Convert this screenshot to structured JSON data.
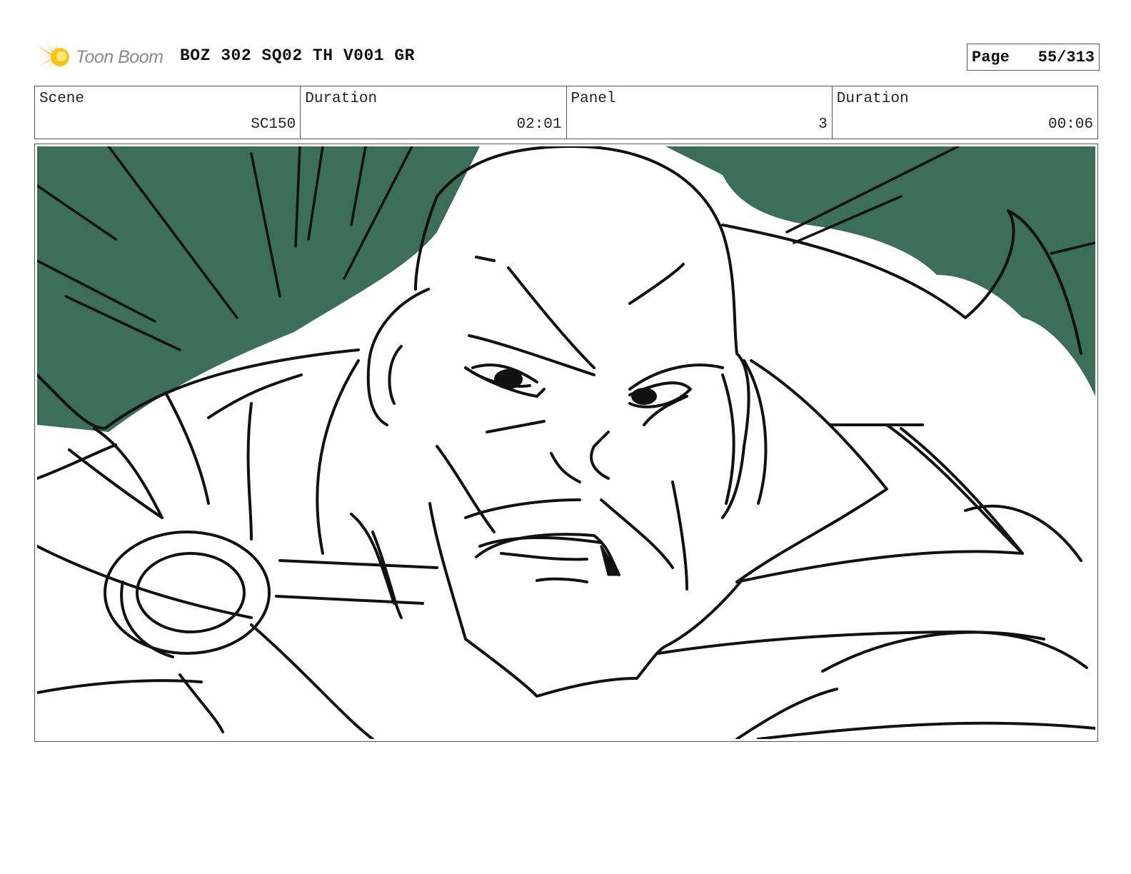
{
  "header": {
    "logo_text": "Toon Boom",
    "title": "BOZ 302 SQ02 TH V001 GR",
    "page_label": "Page",
    "page_value": "55/313"
  },
  "info": {
    "scene_label": "Scene",
    "scene_value": "SC150",
    "scene_duration_label": "Duration",
    "scene_duration_value": "02:01",
    "panel_label": "Panel",
    "panel_value": "3",
    "panel_duration_label": "Duration",
    "panel_duration_value": "00:06"
  },
  "colors": {
    "background_green": "#3d6e5b",
    "line": "#111111",
    "logo_yellow": "#f5c518",
    "logo_text": "#8a8a8a"
  }
}
